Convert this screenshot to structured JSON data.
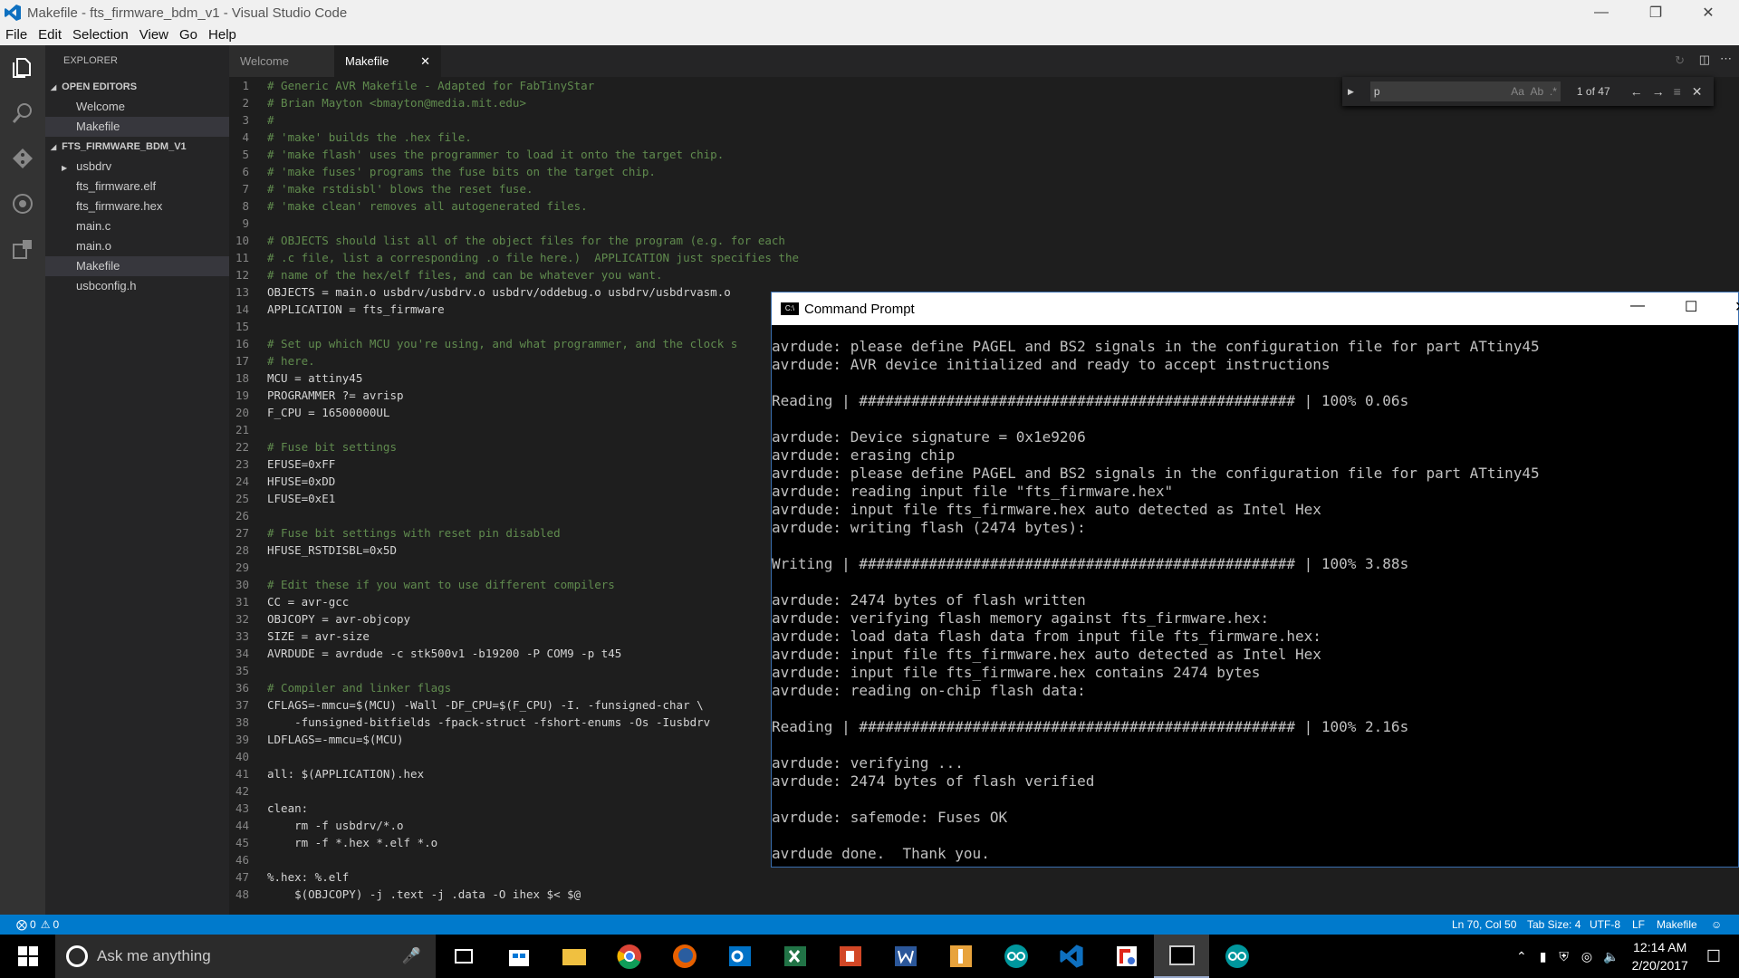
{
  "window": {
    "title": "Makefile - fts_firmware_bdm_v1 - Visual Studio Code"
  },
  "menu": [
    "File",
    "Edit",
    "Selection",
    "View",
    "Go",
    "Help"
  ],
  "sidebar": {
    "header": "EXPLORER",
    "open_editors_label": "OPEN EDITORS",
    "open_editors": [
      "Welcome",
      "Makefile"
    ],
    "project_label": "FTS_FIRMWARE_BDM_V1",
    "files": [
      "usbdrv",
      "fts_firmware.elf",
      "fts_firmware.hex",
      "main.c",
      "main.o",
      "Makefile",
      "usbconfig.h"
    ]
  },
  "tabs": [
    "Welcome",
    "Makefile"
  ],
  "find": {
    "value": "p",
    "count": "1 of 47",
    "opt_case": "Aa",
    "opt_word": "Ab",
    "opt_regex": ".*"
  },
  "code": [
    "# Generic AVR Makefile - Adapted for FabTinyStar",
    "# Brian Mayton <bmayton@media.mit.edu>",
    "#",
    "# 'make' builds the .hex file.",
    "# 'make flash' uses the programmer to load it onto the target chip.",
    "# 'make fuses' programs the fuse bits on the target chip.",
    "# 'make rstdisbl' blows the reset fuse.",
    "# 'make clean' removes all autogenerated files.",
    "",
    "# OBJECTS should list all of the object files for the program (e.g. for each",
    "# .c file, list a corresponding .o file here.)  APPLICATION just specifies the",
    "# name of the hex/elf files, and can be whatever you want.",
    "OBJECTS = main.o usbdrv/usbdrv.o usbdrv/oddebug.o usbdrv/usbdrvasm.o",
    "APPLICATION = fts_firmware",
    "",
    "# Set up which MCU you're using, and what programmer, and the clock s",
    "# here.",
    "MCU = attiny45",
    "PROGRAMMER ?= avrisp",
    "F_CPU = 16500000UL",
    "",
    "# Fuse bit settings",
    "EFUSE=0xFF",
    "HFUSE=0xDD",
    "LFUSE=0xE1",
    "",
    "# Fuse bit settings with reset pin disabled",
    "HFUSE_RSTDISBL=0x5D",
    "",
    "# Edit these if you want to use different compilers",
    "CC = avr-gcc",
    "OBJCOPY = avr-objcopy",
    "SIZE = avr-size",
    "AVRDUDE = avrdude -c stk500v1 -b19200 -P COM9 -p t45",
    "",
    "# Compiler and linker flags",
    "CFLAGS=-mmcu=$(MCU) -Wall -DF_CPU=$(F_CPU) -I. -funsigned-char \\",
    "    -funsigned-bitfields -fpack-struct -fshort-enums -Os -Iusbdrv",
    "LDFLAGS=-mmcu=$(MCU)",
    "",
    "all: $(APPLICATION).hex",
    "",
    "clean:",
    "    rm -f usbdrv/*.o",
    "    rm -f *.hex *.elf *.o",
    "",
    "%.hex: %.elf",
    "    $(OBJCOPY) -j .text -j .data -O ihex $< $@"
  ],
  "cmd": {
    "title": "Command Prompt",
    "icon_text": "C:\\",
    "lines": [
      "avrdude: please define PAGEL and BS2 signals in the configuration file for part ATtiny45",
      "avrdude: AVR device initialized and ready to accept instructions",
      "",
      "Reading | ################################################## | 100% 0.06s",
      "",
      "avrdude: Device signature = 0x1e9206",
      "avrdude: erasing chip",
      "avrdude: please define PAGEL and BS2 signals in the configuration file for part ATtiny45",
      "avrdude: reading input file \"fts_firmware.hex\"",
      "avrdude: input file fts_firmware.hex auto detected as Intel Hex",
      "avrdude: writing flash (2474 bytes):",
      "",
      "Writing | ################################################## | 100% 3.88s",
      "",
      "avrdude: 2474 bytes of flash written",
      "avrdude: verifying flash memory against fts_firmware.hex:",
      "avrdude: load data flash data from input file fts_firmware.hex:",
      "avrdude: input file fts_firmware.hex auto detected as Intel Hex",
      "avrdude: input file fts_firmware.hex contains 2474 bytes",
      "avrdude: reading on-chip flash data:",
      "",
      "Reading | ################################################## | 100% 2.16s",
      "",
      "avrdude: verifying ...",
      "avrdude: 2474 bytes of flash verified",
      "",
      "avrdude: safemode: Fuses OK",
      "",
      "avrdude done.  Thank you."
    ]
  },
  "status": {
    "errors": "0",
    "warnings": "0",
    "position": "Ln 70, Col 50",
    "tabsize": "Tab Size: 4",
    "encoding": "UTF-8",
    "eol": "LF",
    "language": "Makefile"
  },
  "taskbar": {
    "search_placeholder": "Ask me anything",
    "time": "12:14 AM",
    "date": "2/20/2017"
  }
}
